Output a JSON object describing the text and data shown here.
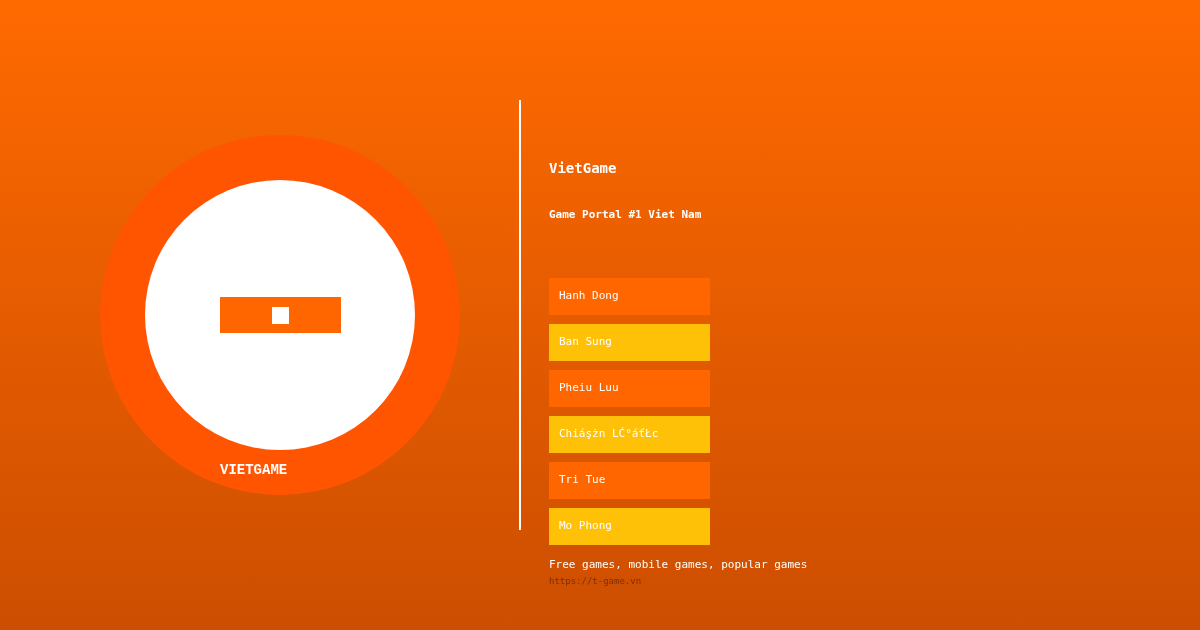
{
  "logo": {
    "label": "VIETGAME"
  },
  "site": {
    "title": "VietGame",
    "tagline": "Game Portal #1 Viet Nam"
  },
  "categories": [
    {
      "label": "Hanh Dong",
      "color": "#ff6600"
    },
    {
      "label": "Ban Sung",
      "color": "#ffc107"
    },
    {
      "label": "Pheiu Luu",
      "color": "#ff6600"
    },
    {
      "label": "Chiáşżn LĆ°áťŁc",
      "color": "#ffc107"
    },
    {
      "label": "Tri Tue",
      "color": "#ff6600"
    },
    {
      "label": "Mo Phong",
      "color": "#ffc107"
    }
  ],
  "footer": {
    "description": "Free games, mobile games, popular games",
    "url": "https://t-game.vn"
  }
}
